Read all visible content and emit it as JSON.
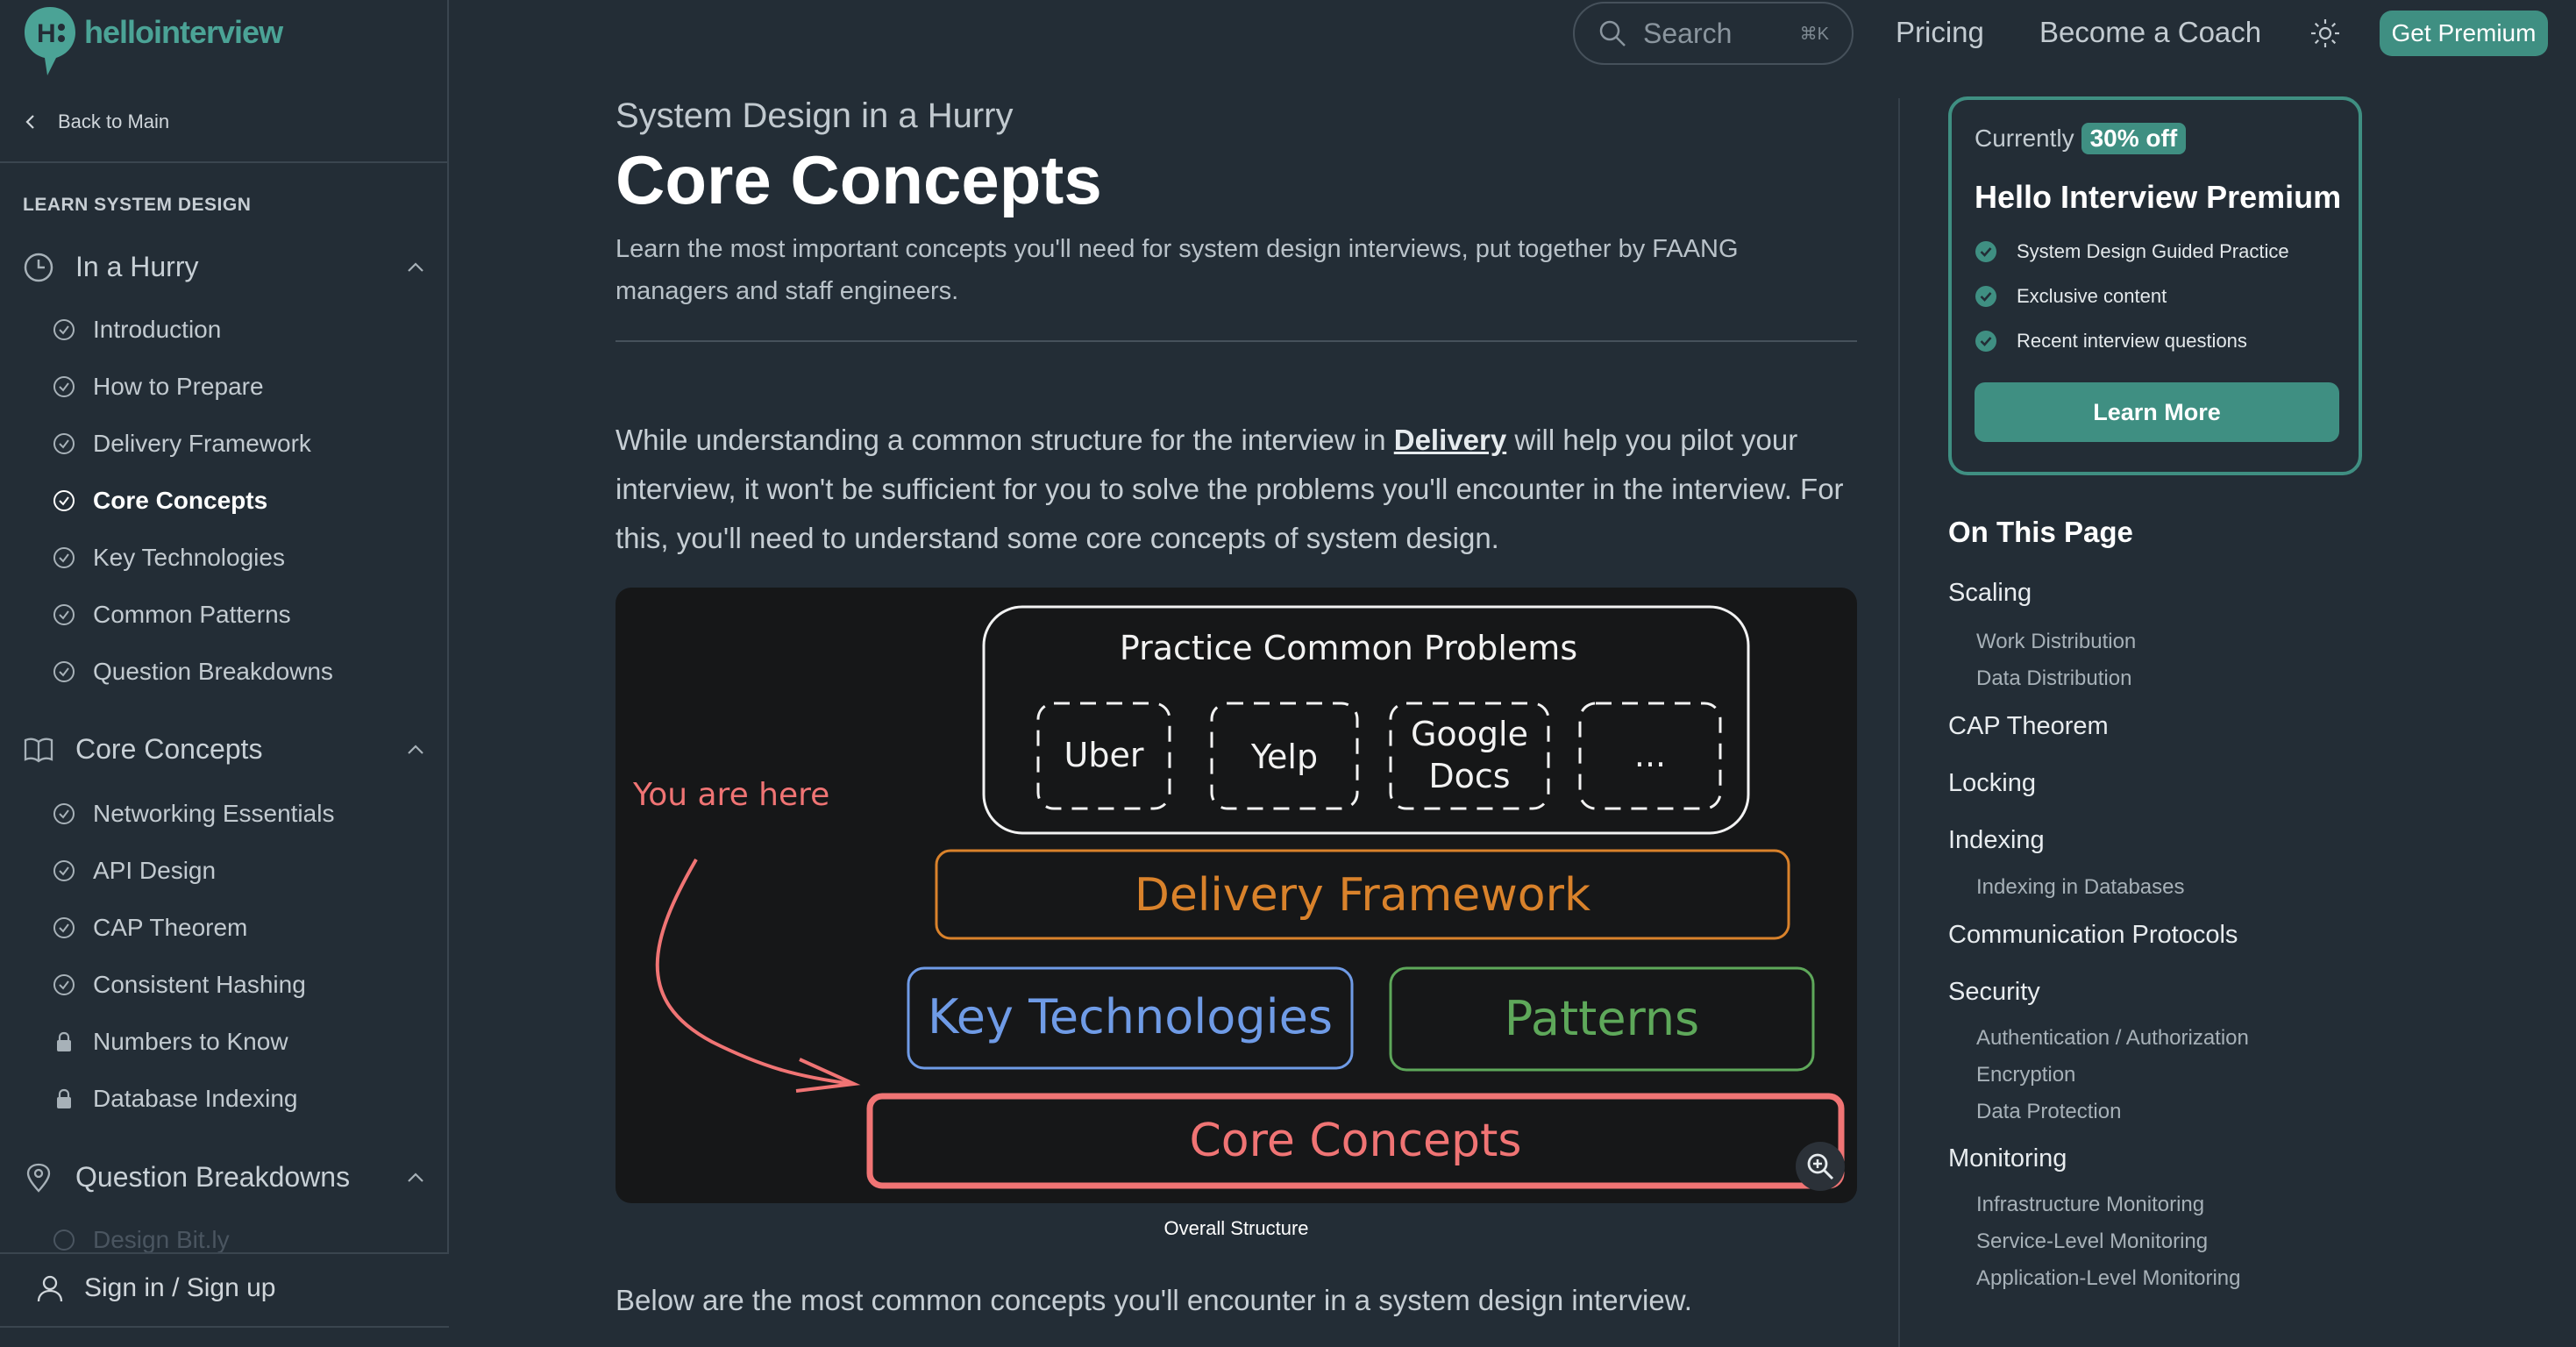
{
  "brand": {
    "name": "hellointerview"
  },
  "sidebar": {
    "back_label": "Back to Main",
    "heading": "LEARN SYSTEM DESIGN",
    "sections": [
      {
        "label": "In a Hurry",
        "icon": "clock-icon"
      },
      {
        "label": "Core Concepts",
        "icon": "book-icon"
      },
      {
        "label": "Question Breakdowns",
        "icon": "location-pin-icon"
      }
    ],
    "hurry_items": [
      "Introduction",
      "How to Prepare",
      "Delivery Framework",
      "Core Concepts",
      "Key Technologies",
      "Common Patterns",
      "Question Breakdowns"
    ],
    "core_items": [
      "Networking Essentials",
      "API Design",
      "CAP Theorem",
      "Consistent Hashing",
      "Numbers to Know",
      "Database Indexing"
    ],
    "breakdown_items": [
      "Design Bit.ly"
    ],
    "signin_label": "Sign in / Sign up"
  },
  "topnav": {
    "search_placeholder": "Search",
    "search_shortcut": "⌘K",
    "links": [
      "Pricing",
      "Become a Coach"
    ],
    "premium_label": "Get Premium"
  },
  "main": {
    "breadcrumb": "System Design in a Hurry",
    "title": "Core Concepts",
    "subtitle": "Learn the most important concepts you'll need for system design interviews, put together by FAANG managers and staff engineers.",
    "intro_before": "While understanding a common structure for the interview in ",
    "intro_link": "Delivery",
    "intro_after": " will help you pilot your interview, it won't be sufficient for you to solve the problems you'll encounter in the interview. For this, you'll need to understand some core concepts of system design.",
    "figure": {
      "top_box": "Practice Common Problems",
      "problems": [
        "Uber",
        "Yelp",
        "Google",
        "Docs",
        "..."
      ],
      "you_are_here": "You are here",
      "delivery": "Delivery Framework",
      "key_tech": "Key Technologies",
      "patterns": "Patterns",
      "core": "Core Concepts",
      "colors": {
        "delivery": "#d9822b",
        "key_tech": "#6f9be6",
        "patterns": "#5ea85a",
        "core": "#f07474",
        "white": "#f2f2f2"
      }
    },
    "caption": "Overall Structure",
    "below_text": "Below are the most common concepts you'll encounter in a system design interview."
  },
  "premium_card": {
    "currently": "Currently",
    "discount": "30% off",
    "title": "Hello Interview Premium",
    "features": [
      "System Design Guided Practice",
      "Exclusive content",
      "Recent interview questions"
    ],
    "cta": "Learn More"
  },
  "toc": {
    "heading": "On This Page",
    "main": [
      "Scaling",
      "CAP Theorem",
      "Locking",
      "Indexing",
      "Communication Protocols",
      "Security",
      "Monitoring"
    ],
    "sub": {
      "scaling": [
        "Work Distribution",
        "Data Distribution"
      ],
      "indexing": [
        "Indexing in Databases"
      ],
      "security": [
        "Authentication / Authorization",
        "Encryption",
        "Data Protection"
      ],
      "monitoring": [
        "Infrastructure Monitoring",
        "Service-Level Monitoring",
        "Application-Level Monitoring"
      ]
    }
  },
  "colors": {
    "accent": "#3f8f82",
    "background": "#232d36"
  }
}
